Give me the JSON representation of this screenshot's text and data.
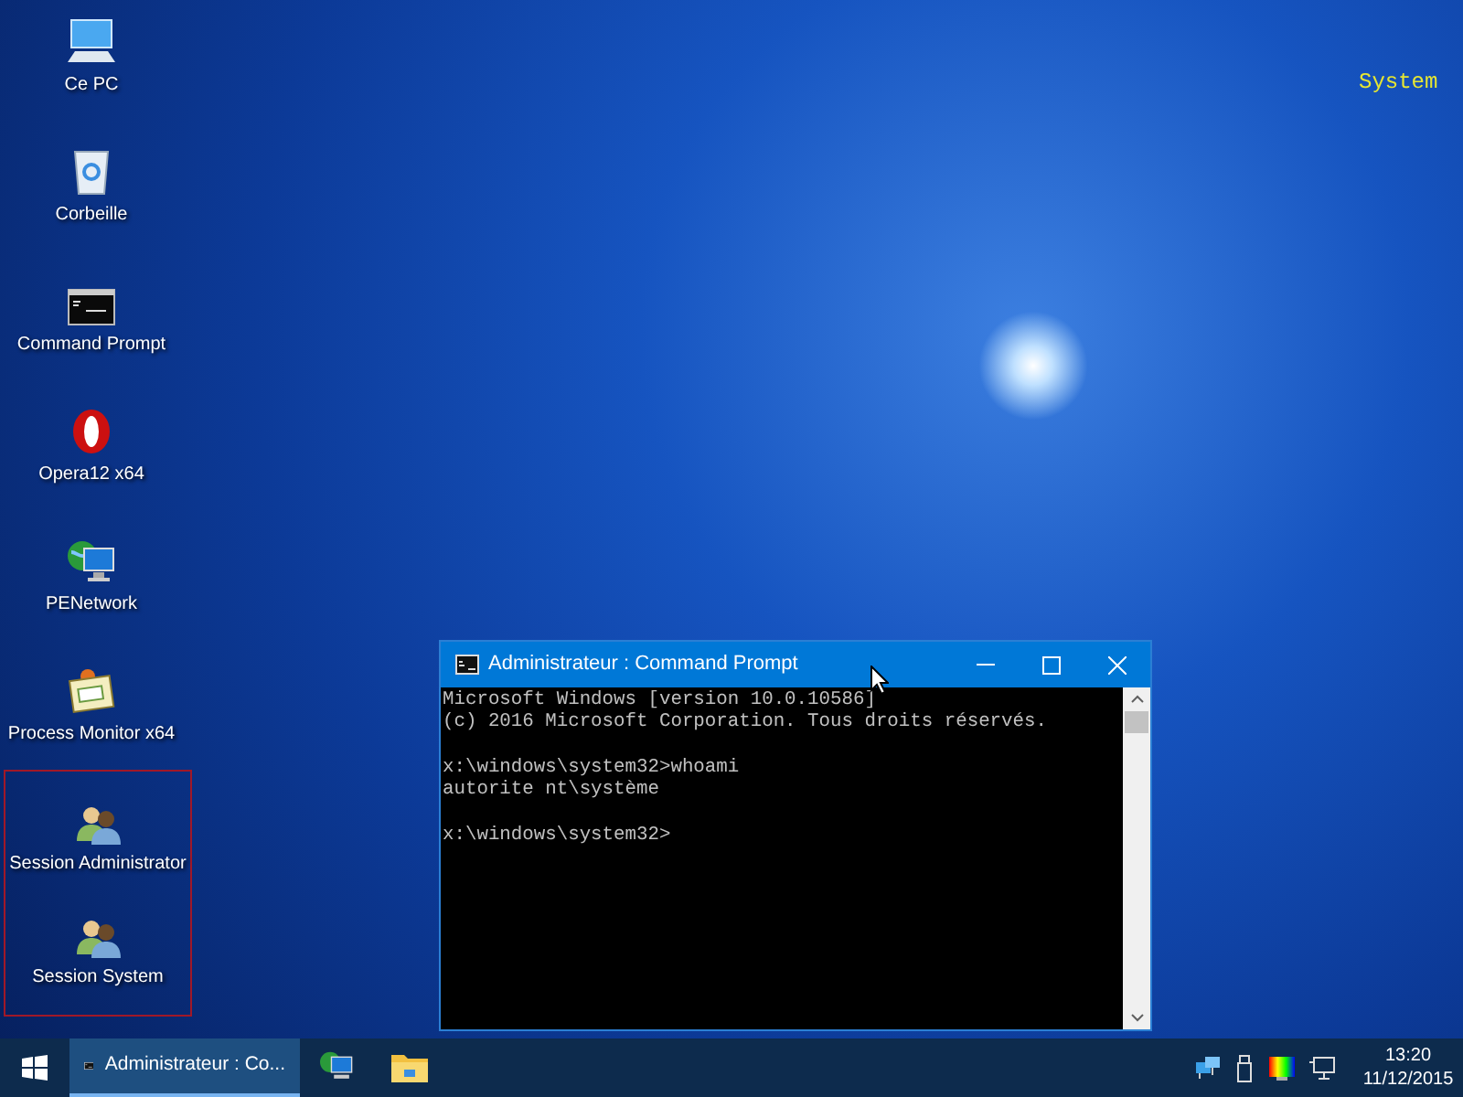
{
  "desktop_icons": [
    {
      "label": "Ce PC",
      "kind": "pc"
    },
    {
      "label": "Corbeille",
      "kind": "bin"
    },
    {
      "label": "Command Prompt",
      "kind": "console"
    },
    {
      "label": "Opera12 x64",
      "kind": "opera"
    },
    {
      "label": "PENetwork",
      "kind": "network"
    },
    {
      "label": "Process Monitor x64",
      "kind": "monitor"
    }
  ],
  "session_icons": [
    {
      "label": "Session Administrator",
      "kind": "users"
    },
    {
      "label": "Session System",
      "kind": "users"
    }
  ],
  "overlay_text": "System",
  "console_window": {
    "title": "Administrateur : Command Prompt",
    "blocks": [
      [
        "Microsoft Windows [version 10.0.10586]",
        "(c) 2016 Microsoft Corporation. Tous droits réservés."
      ],
      [
        "x:\\windows\\system32>whoami",
        "autorite nt\\système"
      ],
      [
        "x:\\windows\\system32>"
      ]
    ]
  },
  "taskbar": {
    "items": [
      {
        "kind": "console",
        "label": "Administrateur : Co...",
        "selected": true
      },
      {
        "kind": "network",
        "selected": false
      },
      {
        "kind": "folder",
        "selected": false
      }
    ],
    "clock": {
      "time": "13:20",
      "date": "11/12/2015"
    }
  }
}
